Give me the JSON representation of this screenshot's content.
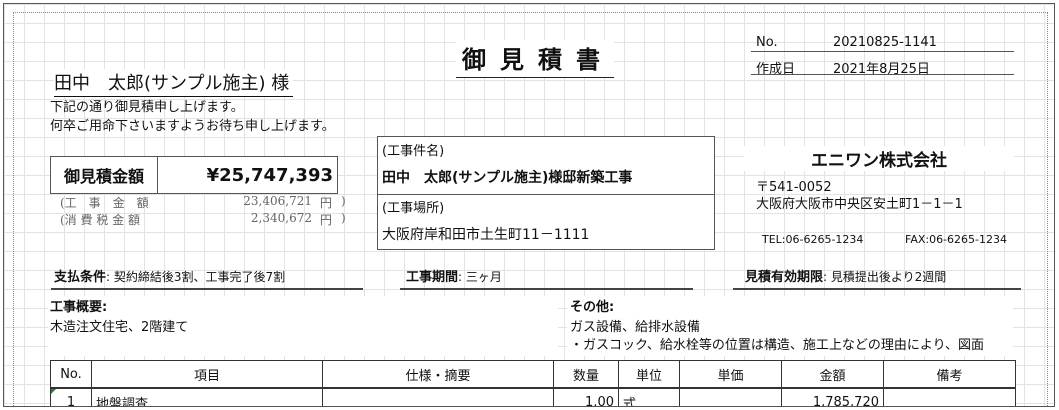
{
  "title": "御見積書",
  "meta": {
    "no_label": "No.",
    "no_value": "20210825-1141",
    "date_label": "作成日",
    "date_value": "2021年8月25日"
  },
  "client": {
    "name": "田中　太郎(サンプル施主) 様",
    "line1": "下記の通り御見積申し上げます。",
    "line2": "何卒ご用命下さいますようお待ち申し上げます。"
  },
  "amount": {
    "label": "御見積金額",
    "total": "¥25,747,393",
    "work_label": "(工　事　金　額",
    "work_value": "23,406,721",
    "tax_label": "(消 費 税 金 額",
    "tax_value": "2,340,672",
    "yen": "円",
    "close": ")"
  },
  "project": {
    "name_label": "(工事件名)",
    "name": "田中　太郎(サンプル施主)様邸新築工事",
    "place_label": "(工事場所)",
    "place": "大阪府岸和田市土生町11－1111"
  },
  "company": {
    "name": "エニワン株式会社",
    "zip": "〒541-0052",
    "address": "大阪府大阪市中央区安土町1－1－1",
    "tel": "TEL:06-6265-1234",
    "fax": "FAX:06-6265-1234"
  },
  "conditions": {
    "payment_label": "支払条件",
    "payment": "契約締結後3割、工事完了後7割",
    "period_label": "工事期間",
    "period": "三ヶ月",
    "validity_label": "見積有効期限",
    "validity": "見積提出後より2週間"
  },
  "summary": {
    "label": "工事概要",
    "text": "木造注文住宅、2階建て"
  },
  "other": {
    "label": "その他",
    "line1": "ガス設備、給排水設備",
    "line2": "・ガスコック、給水栓等の位置は構造、施工上などの理由により、図面"
  },
  "table": {
    "headers": [
      "No.",
      "項目",
      "仕様・摘要",
      "数量",
      "単位",
      "単価",
      "金額",
      "備考"
    ],
    "rows": [
      [
        "1",
        "地盤調査",
        "",
        "1.00",
        "式",
        "",
        "1,785,720",
        ""
      ]
    ]
  }
}
